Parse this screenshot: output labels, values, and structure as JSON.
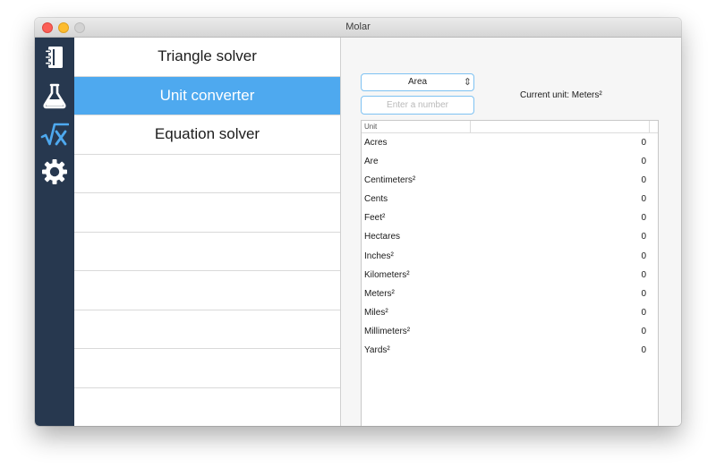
{
  "window": {
    "title": "Molar"
  },
  "iconbar": {
    "items": [
      {
        "name": "notebook-icon"
      },
      {
        "name": "flask-icon"
      },
      {
        "name": "sqrt-x-icon",
        "active": true
      },
      {
        "name": "gear-icon"
      }
    ],
    "accent": "#4ea9ef",
    "background": "#27384f"
  },
  "list": {
    "items": [
      "Triangle solver",
      "Unit converter",
      "Equation solver",
      "",
      "",
      "",
      "",
      "",
      "",
      ""
    ],
    "selected": "Unit converter",
    "selected_color": "#4ea9ef"
  },
  "converter": {
    "category": "Area",
    "input_value": "",
    "input_placeholder": "Enter a number",
    "current_unit_label": "Current unit: Meters²",
    "table": {
      "header": "Unit",
      "rows": [
        {
          "unit": "Acres",
          "value": "0"
        },
        {
          "unit": "Are",
          "value": "0"
        },
        {
          "unit": "Centimeters²",
          "value": "0"
        },
        {
          "unit": "Cents",
          "value": "0"
        },
        {
          "unit": "Feet²",
          "value": "0"
        },
        {
          "unit": "Hectares",
          "value": "0"
        },
        {
          "unit": "Inches²",
          "value": "0"
        },
        {
          "unit": "Kilometers²",
          "value": "0"
        },
        {
          "unit": "Meters²",
          "value": "0"
        },
        {
          "unit": "Miles²",
          "value": "0"
        },
        {
          "unit": "Millimeters²",
          "value": "0"
        },
        {
          "unit": "Yards²",
          "value": "0"
        }
      ]
    }
  }
}
